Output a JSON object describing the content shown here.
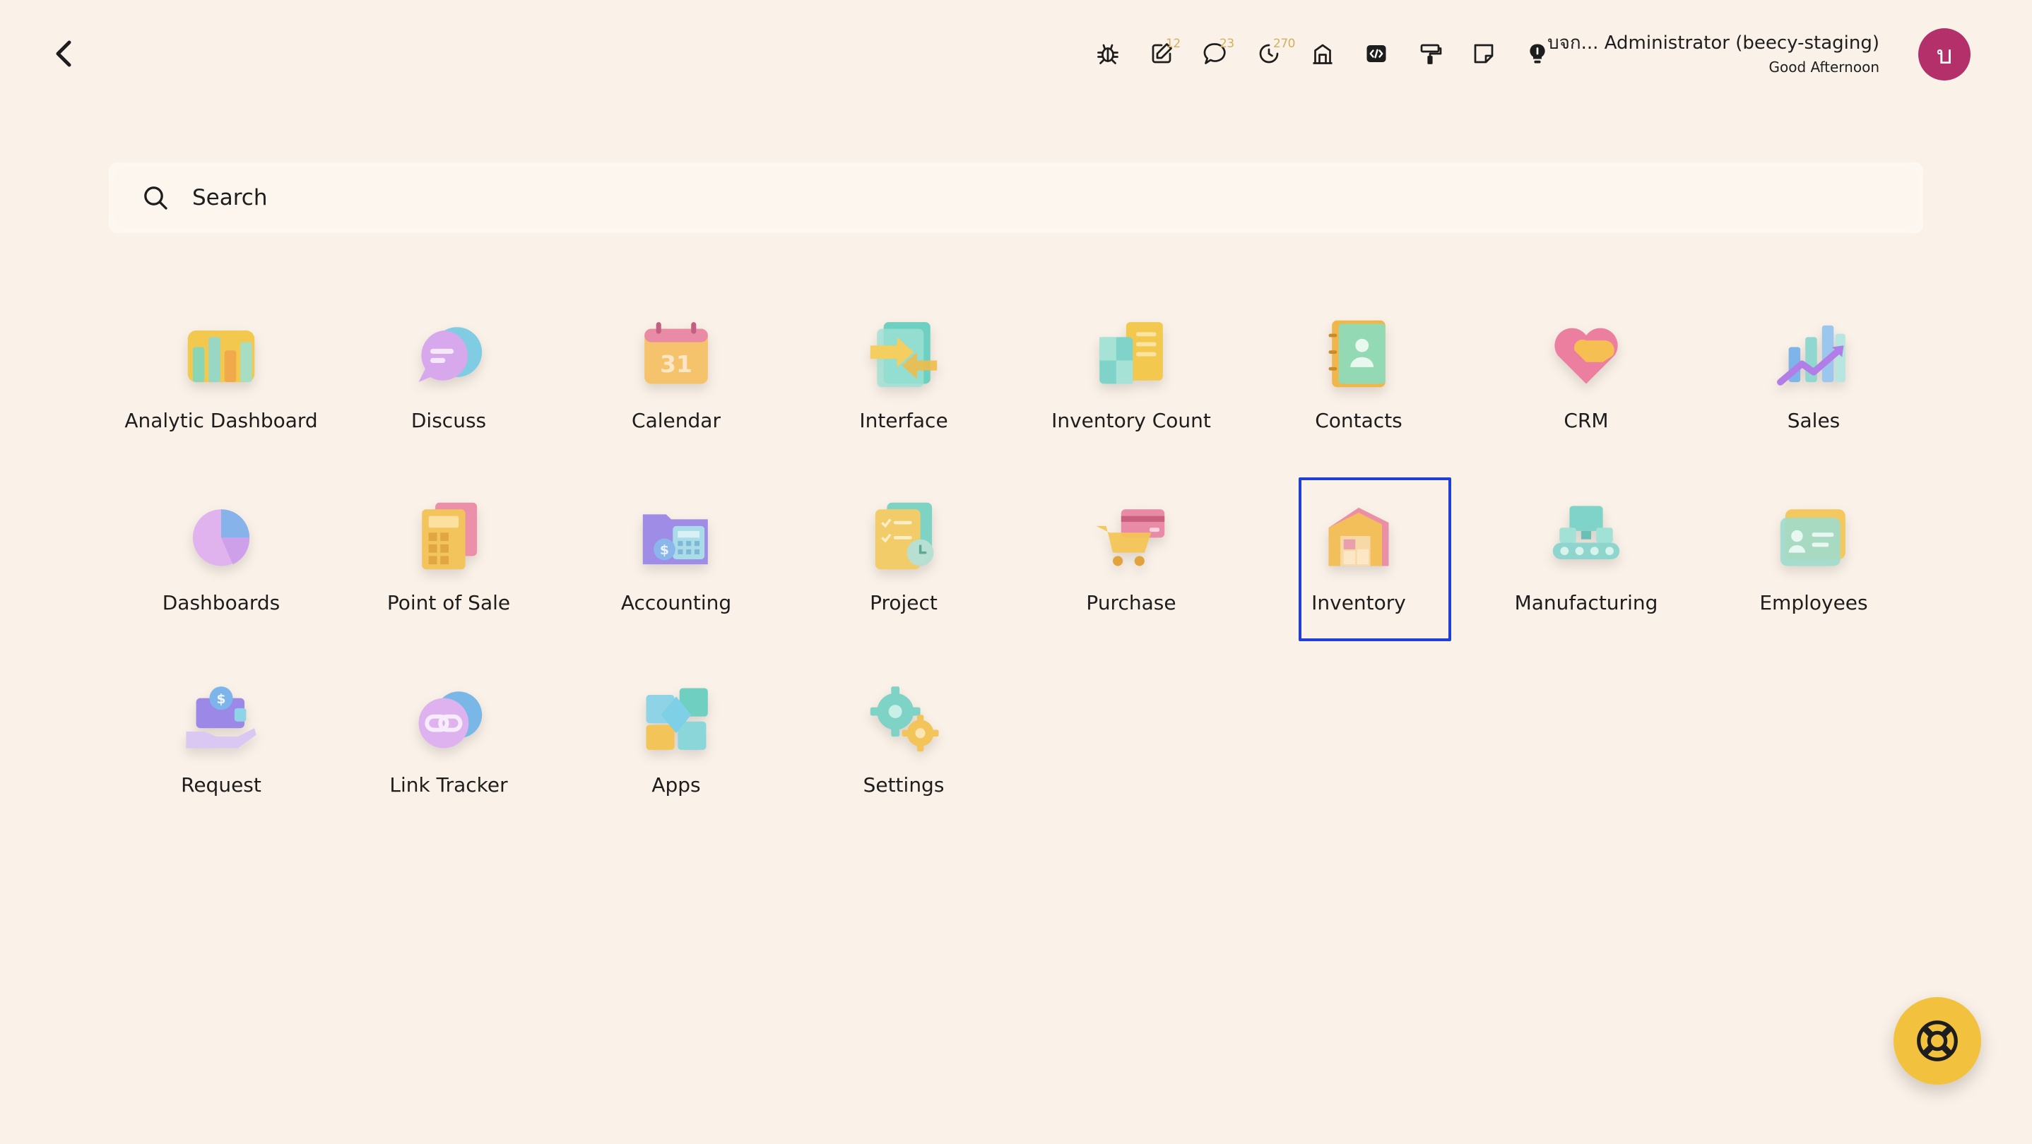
{
  "header": {
    "back_icon": "chevron-left-icon",
    "systray": [
      {
        "name": "bug-icon",
        "badge": ""
      },
      {
        "name": "edit-note-icon",
        "badge": "12"
      },
      {
        "name": "chat-icon",
        "badge": "23"
      },
      {
        "name": "activity-clock-icon",
        "badge": "270"
      },
      {
        "name": "building-icon",
        "badge": ""
      },
      {
        "name": "code-icon",
        "badge": ""
      },
      {
        "name": "paint-roller-icon",
        "badge": ""
      },
      {
        "name": "sticky-note-icon",
        "badge": ""
      },
      {
        "name": "lightbulb-icon",
        "badge": ""
      }
    ],
    "user": {
      "name": "บจก... Administrator (beecy-staging)",
      "greeting": "Good Afternoon",
      "avatar_letter": "บ",
      "avatar_color": "#b3306b"
    }
  },
  "search": {
    "placeholder": "Search",
    "value": ""
  },
  "apps": [
    {
      "label": "Analytic Dashboard",
      "icon": "bar-chart-icon"
    },
    {
      "label": "Discuss",
      "icon": "chat-bubbles-icon"
    },
    {
      "label": "Calendar",
      "icon": "calendar-icon"
    },
    {
      "label": "Interface",
      "icon": "interface-arrows-icon"
    },
    {
      "label": "Inventory Count",
      "icon": "inventory-count-icon"
    },
    {
      "label": "Contacts",
      "icon": "contacts-book-icon"
    },
    {
      "label": "CRM",
      "icon": "heart-handshake-icon"
    },
    {
      "label": "Sales",
      "icon": "sales-chart-icon"
    },
    {
      "label": "Dashboards",
      "icon": "pie-chart-icon"
    },
    {
      "label": "Point of Sale",
      "icon": "pos-terminal-icon"
    },
    {
      "label": "Accounting",
      "icon": "accounting-folder-icon"
    },
    {
      "label": "Project",
      "icon": "project-checklist-icon"
    },
    {
      "label": "Purchase",
      "icon": "shopping-cart-icon"
    },
    {
      "label": "Inventory",
      "icon": "warehouse-icon",
      "selected": true
    },
    {
      "label": "Manufacturing",
      "icon": "conveyor-icon"
    },
    {
      "label": "Employees",
      "icon": "id-card-icon"
    },
    {
      "label": "Request",
      "icon": "hand-money-icon"
    },
    {
      "label": "Link Tracker",
      "icon": "link-icon"
    },
    {
      "label": "Apps",
      "icon": "apps-cubes-icon"
    },
    {
      "label": "Settings",
      "icon": "gears-icon"
    }
  ],
  "colors": {
    "background": "#faf1e8",
    "selection_border": "#1f3fd6",
    "help_button": "#f2c23e",
    "badge_text": "#d3b160"
  },
  "help": {
    "icon": "lifebuoy-icon"
  }
}
